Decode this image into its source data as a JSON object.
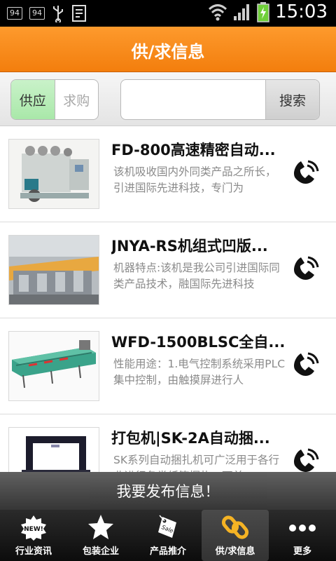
{
  "status_bar": {
    "left_badges": [
      "94",
      "94"
    ],
    "time": "15:03"
  },
  "header": {
    "title": "供/求信息"
  },
  "search": {
    "tabs": [
      {
        "label": "供应",
        "active": true
      },
      {
        "label": "求购",
        "active": false
      }
    ],
    "input_value": "",
    "button_label": "搜索"
  },
  "items": [
    {
      "title": "FD-800高速精密自动...",
      "desc": "该机吸收国内外同类产品之所长，引进国际先进科技，专门为"
    },
    {
      "title": "JNYA-RS机组式凹版...",
      "desc": "机器特点:该机是我公司引进国际同类产品技术，融国际先进科技"
    },
    {
      "title": "WFD-1500BLSC全自...",
      "desc": "性能用途：1.电气控制系统采用PLC集中控制，由触摸屏进行人"
    },
    {
      "title": "打包机|SK-2A自动捆...",
      "desc": "SK系列自动捆扎机可广泛用于各行业进行各类纸箱捆扎，可单"
    }
  ],
  "publish_bar": {
    "label": "我要发布信息！"
  },
  "bottom_nav": {
    "items": [
      {
        "label": "行业资讯",
        "icon": "new-badge-icon",
        "badge_text": "NEW!"
      },
      {
        "label": "包装企业",
        "icon": "star-icon"
      },
      {
        "label": "产品推介",
        "icon": "sale-tag-icon",
        "badge_text": "Sale"
      },
      {
        "label": "供/求信息",
        "icon": "chain-link-icon",
        "active": true
      },
      {
        "label": "更多",
        "icon": "more-dots-icon"
      }
    ]
  },
  "colors": {
    "header_orange": "#f58a1a",
    "tab_active_green": "#b5ecb5"
  }
}
